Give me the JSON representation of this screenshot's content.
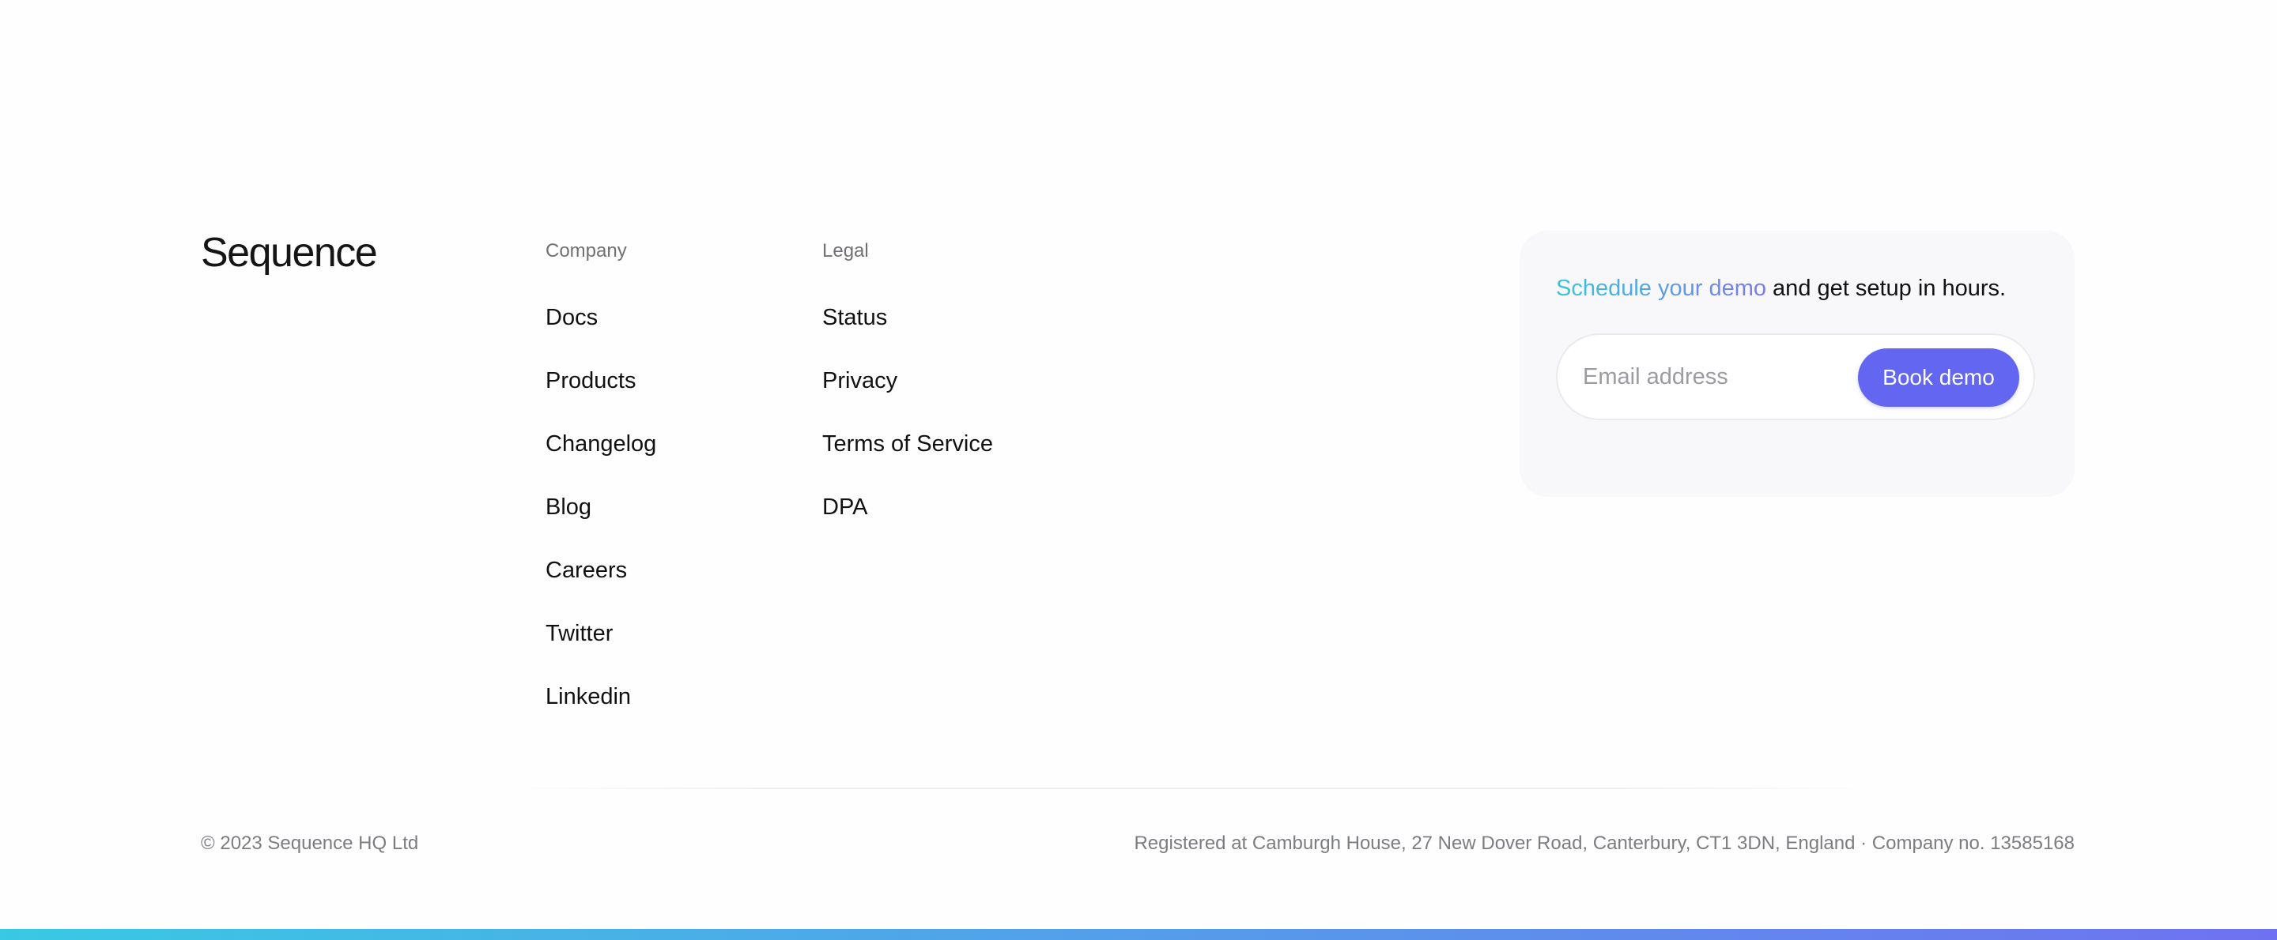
{
  "brand": {
    "name": "Sequence"
  },
  "footer_nav": {
    "company": {
      "heading": "Company",
      "links": [
        "Docs",
        "Products",
        "Changelog",
        "Blog",
        "Careers",
        "Twitter",
        "Linkedin"
      ]
    },
    "legal": {
      "heading": "Legal",
      "links": [
        "Status",
        "Privacy",
        "Terms of Service",
        "DPA"
      ]
    }
  },
  "demo": {
    "highlight_text": "Schedule your demo",
    "rest_text": " and get setup in hours.",
    "email_placeholder": "Email address",
    "email_value": "",
    "button_label": "Book demo"
  },
  "bottom": {
    "copyright": "© 2023 Sequence HQ Ltd",
    "registered": "Registered at Camburgh House, 27 New Dover Road, Canterbury, CT1 3DN, England · Company no. 13585168"
  },
  "colors": {
    "accent_start": "#38c6dd",
    "accent_end": "#6f72f0",
    "button": "#6366f1",
    "card_background": "#f8f7fa",
    "muted_text": "#7b7d80"
  }
}
